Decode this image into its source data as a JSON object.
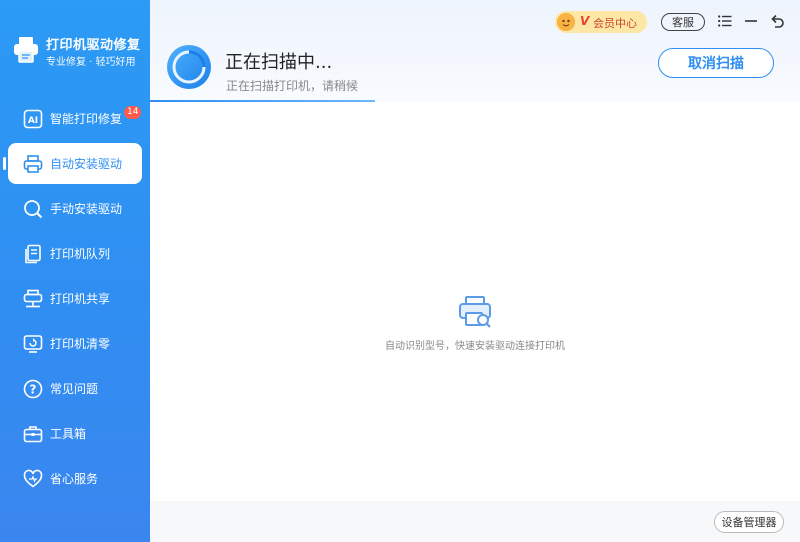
{
  "brand": {
    "title": "打印机驱动修复",
    "subtitle": "专业修复 · 轻巧好用"
  },
  "sidebar": {
    "items": [
      {
        "label": "智能打印修复",
        "icon": "ai-icon",
        "badge": "14"
      },
      {
        "label": "自动安装驱动",
        "icon": "printer-icon",
        "active": true
      },
      {
        "label": "手动安装驱动",
        "icon": "search-icon"
      },
      {
        "label": "打印机队列",
        "icon": "queue-icon"
      },
      {
        "label": "打印机共享",
        "icon": "share-icon"
      },
      {
        "label": "打印机清零",
        "icon": "reset-icon"
      },
      {
        "label": "常见问题",
        "icon": "question-icon"
      },
      {
        "label": "工具箱",
        "icon": "toolbox-icon"
      },
      {
        "label": "省心服务",
        "icon": "heart-icon"
      }
    ]
  },
  "topbar": {
    "vip_v": "V",
    "vip_label": "会员中心",
    "support_label": "客服"
  },
  "scan": {
    "title": "正在扫描中...",
    "subtitle": "正在扫描打印机，请稍候",
    "cancel_label": "取消扫描"
  },
  "empty": {
    "text": "自动识别型号，快速安装驱动连接打印机"
  },
  "footer": {
    "device_manager_label": "设备管理器"
  },
  "colors": {
    "accent": "#2f8ff2",
    "badge": "#ff5a4e",
    "vip_bg": "#fde7a7"
  }
}
